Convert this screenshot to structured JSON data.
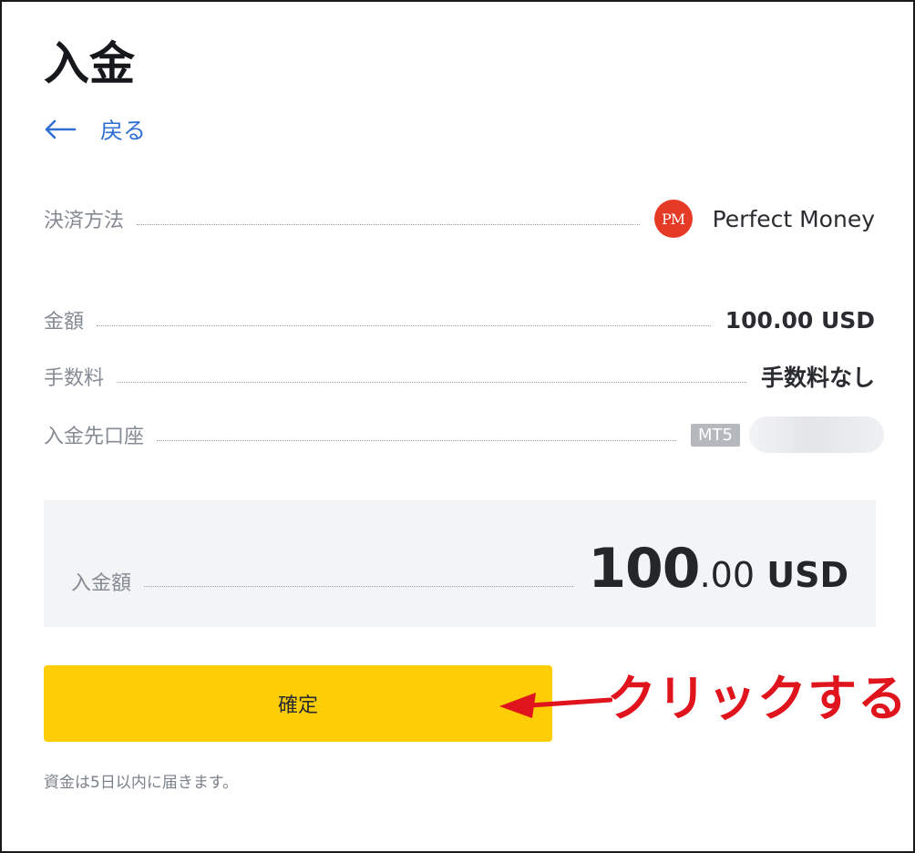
{
  "page": {
    "title": "入金"
  },
  "nav": {
    "back_label": "戻る",
    "back_icon": "arrow-left-icon"
  },
  "details": {
    "payment_method": {
      "label": "決済方法",
      "logo_text": "PM",
      "value": "Perfect Money"
    },
    "amount": {
      "label": "金額",
      "value": "100.00 USD"
    },
    "fee": {
      "label": "手数料",
      "value": "手数料なし"
    },
    "account": {
      "label": "入金先口座",
      "platform_badge": "MT5"
    }
  },
  "summary": {
    "label": "入金額",
    "amount_int": "100",
    "amount_dec": ".00",
    "currency": " USD"
  },
  "actions": {
    "confirm_label": "確定"
  },
  "annotation": {
    "text": "クリックする",
    "color": "#e0141c"
  },
  "footer": {
    "note": "資金は5日以内に届きます。"
  },
  "colors": {
    "accent": "#fdcd06",
    "link": "#2f6fd2",
    "perfect_money": "#e53b26",
    "panel_bg": "#f3f4f6"
  }
}
